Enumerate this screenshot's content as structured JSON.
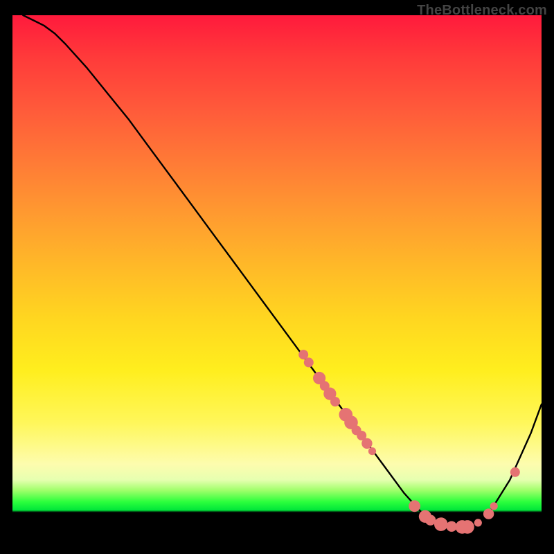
{
  "watermark": "TheBottleneck.com",
  "chart_data": {
    "type": "line",
    "title": "",
    "xlabel": "",
    "ylabel": "",
    "xlim": [
      0,
      100
    ],
    "ylim": [
      0,
      100
    ],
    "grid": false,
    "series": [
      {
        "name": "curve",
        "x": [
          2,
          4,
          6,
          8,
          10,
          14,
          18,
          22,
          26,
          30,
          34,
          38,
          42,
          46,
          50,
          54,
          58,
          62,
          66,
          70,
          74,
          78,
          82,
          86,
          90,
          94,
          98,
          100
        ],
        "values": [
          100,
          99,
          98,
          96.5,
          94.5,
          90,
          85,
          80,
          74.5,
          69,
          63.5,
          58,
          52.5,
          47,
          41.5,
          36,
          30.5,
          25,
          19.5,
          14,
          8.5,
          4,
          2.2,
          2.0,
          4.5,
          11,
          20,
          25.5
        ]
      }
    ],
    "points": [
      {
        "x": 55,
        "y": 35,
        "r": 1.0
      },
      {
        "x": 56,
        "y": 33.5,
        "r": 1.0
      },
      {
        "x": 58,
        "y": 30.5,
        "r": 1.3
      },
      {
        "x": 59,
        "y": 29,
        "r": 1.0
      },
      {
        "x": 60,
        "y": 27.5,
        "r": 1.3
      },
      {
        "x": 61,
        "y": 26,
        "r": 1.0
      },
      {
        "x": 63,
        "y": 23.5,
        "r": 1.4
      },
      {
        "x": 64,
        "y": 22,
        "r": 1.4
      },
      {
        "x": 65,
        "y": 20.5,
        "r": 1.0
      },
      {
        "x": 66,
        "y": 19.5,
        "r": 1.0
      },
      {
        "x": 67,
        "y": 18,
        "r": 1.1
      },
      {
        "x": 68,
        "y": 16.5,
        "r": 0.8
      },
      {
        "x": 76,
        "y": 6,
        "r": 1.2
      },
      {
        "x": 78,
        "y": 4,
        "r": 1.3
      },
      {
        "x": 79,
        "y": 3.3,
        "r": 1.1
      },
      {
        "x": 81,
        "y": 2.5,
        "r": 1.4
      },
      {
        "x": 83,
        "y": 2.1,
        "r": 1.1
      },
      {
        "x": 85,
        "y": 2.0,
        "r": 1.4
      },
      {
        "x": 86,
        "y": 2.0,
        "r": 1.4
      },
      {
        "x": 88,
        "y": 2.8,
        "r": 0.8
      },
      {
        "x": 90,
        "y": 4.5,
        "r": 1.1
      },
      {
        "x": 91,
        "y": 6,
        "r": 0.8
      },
      {
        "x": 95,
        "y": 12.5,
        "r": 1.0
      }
    ],
    "gradient_stops": [
      {
        "pos": 0.0,
        "color": "#ff1a3c"
      },
      {
        "pos": 0.5,
        "color": "#ffd620"
      },
      {
        "pos": 0.88,
        "color": "#fdfcae"
      },
      {
        "pos": 0.94,
        "color": "#00e63a"
      },
      {
        "pos": 0.96,
        "color": "#000000"
      }
    ]
  }
}
